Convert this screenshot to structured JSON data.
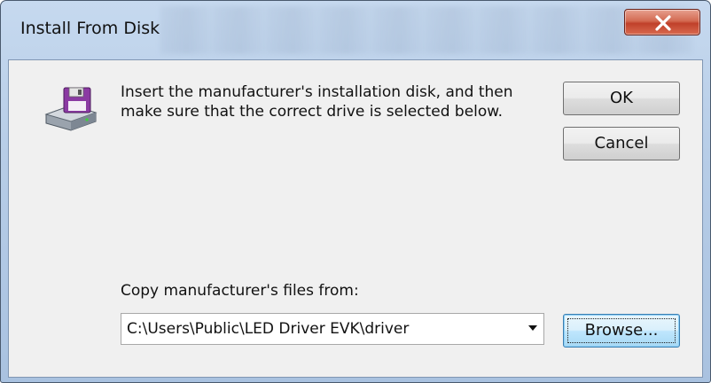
{
  "window": {
    "title": "Install From Disk"
  },
  "icons": {
    "close": "close-icon",
    "disk": "floppy-disk-drive-icon",
    "dropdown": "chevron-down-icon"
  },
  "message": {
    "text": "Insert the manufacturer's installation disk, and then make sure that the correct drive is selected below."
  },
  "buttons": {
    "ok_label": "OK",
    "cancel_label": "Cancel",
    "browse_label": "Browse..."
  },
  "copy_from": {
    "label": "Copy manufacturer's files from:",
    "value": "C:\\Users\\Public\\LED Driver EVK\\driver"
  },
  "colors": {
    "close_button": "#c74a33",
    "focus_button_border": "#3c7fb1",
    "dialog_background": "#f0f0f0"
  }
}
